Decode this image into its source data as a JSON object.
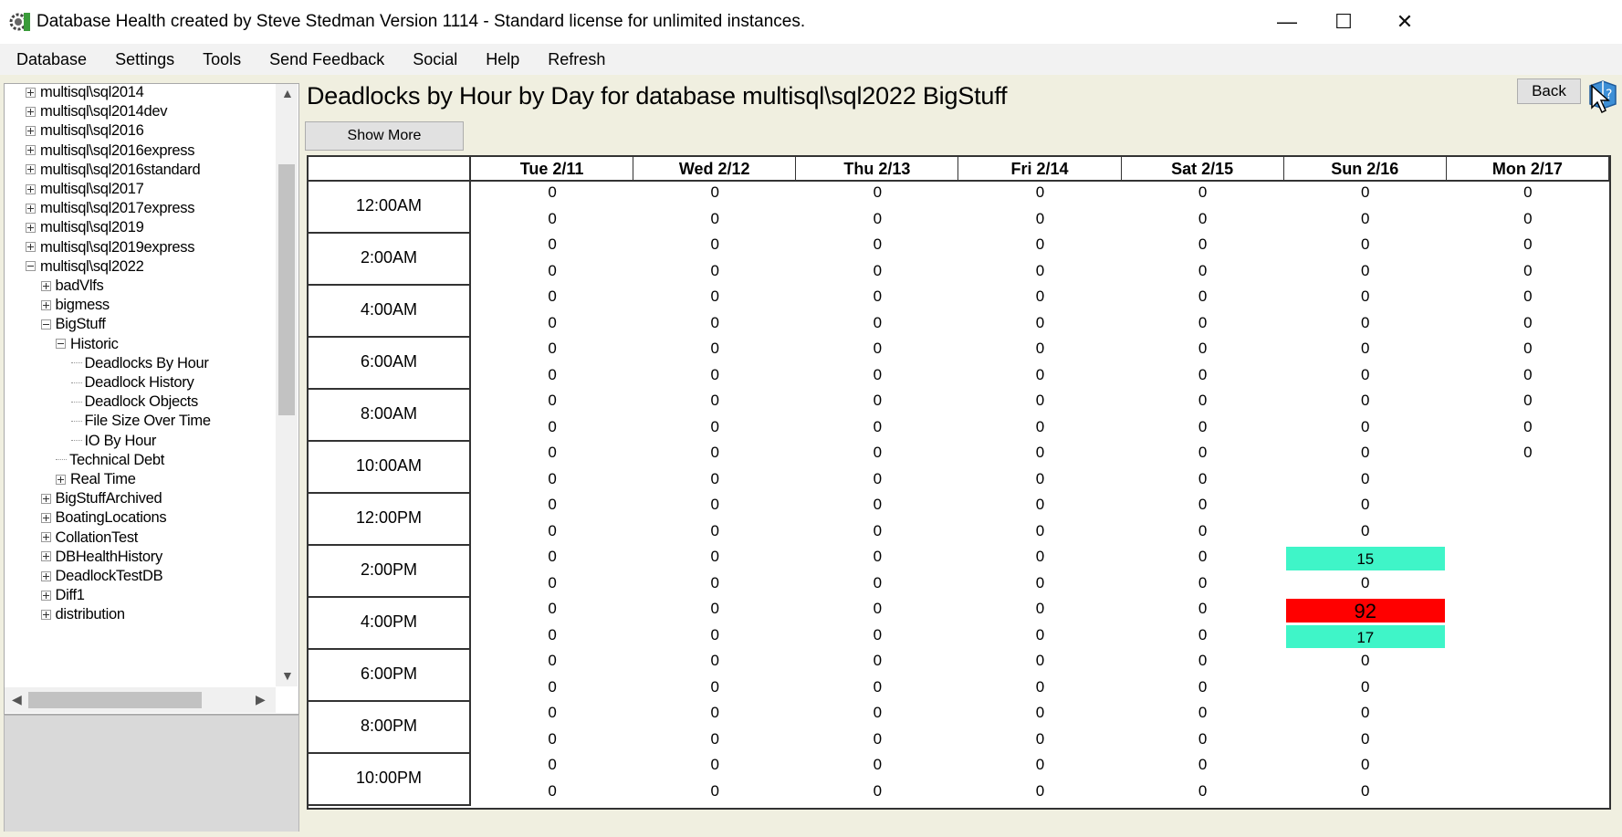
{
  "window": {
    "title": "Database Health created by Steve Stedman Version 1114 - Standard license for unlimited instances.",
    "minimize": "—",
    "maximize": "☐",
    "close": "✕"
  },
  "menu": [
    "Database",
    "Settings",
    "Tools",
    "Send Feedback",
    "Social",
    "Help",
    "Refresh"
  ],
  "tree": [
    {
      "label": "multisql\\sql2014",
      "indent": 0,
      "type": "plus"
    },
    {
      "label": "multisql\\sql2014dev",
      "indent": 0,
      "type": "plus"
    },
    {
      "label": "multisql\\sql2016",
      "indent": 0,
      "type": "plus"
    },
    {
      "label": "multisql\\sql2016express",
      "indent": 0,
      "type": "plus"
    },
    {
      "label": "multisql\\sql2016standard",
      "indent": 0,
      "type": "plus"
    },
    {
      "label": "multisql\\sql2017",
      "indent": 0,
      "type": "plus"
    },
    {
      "label": "multisql\\sql2017express",
      "indent": 0,
      "type": "plus"
    },
    {
      "label": "multisql\\sql2019",
      "indent": 0,
      "type": "plus"
    },
    {
      "label": "multisql\\sql2019express",
      "indent": 0,
      "type": "plus"
    },
    {
      "label": "multisql\\sql2022",
      "indent": 0,
      "type": "minus"
    },
    {
      "label": "badVlfs",
      "indent": 1,
      "type": "plus"
    },
    {
      "label": "bigmess",
      "indent": 1,
      "type": "plus"
    },
    {
      "label": "BigStuff",
      "indent": 1,
      "type": "minus"
    },
    {
      "label": "Historic",
      "indent": 2,
      "type": "minus"
    },
    {
      "label": "Deadlocks By Hour",
      "indent": 3,
      "type": "leaf"
    },
    {
      "label": "Deadlock History",
      "indent": 3,
      "type": "leaf"
    },
    {
      "label": "Deadlock Objects",
      "indent": 3,
      "type": "leaf"
    },
    {
      "label": "File Size Over Time",
      "indent": 3,
      "type": "leaf"
    },
    {
      "label": "IO By Hour",
      "indent": 3,
      "type": "leaf"
    },
    {
      "label": "Technical Debt",
      "indent": 2,
      "type": "leaf"
    },
    {
      "label": "Real Time",
      "indent": 2,
      "type": "plus"
    },
    {
      "label": "BigStuffArchived",
      "indent": 1,
      "type": "plus"
    },
    {
      "label": "BoatingLocations",
      "indent": 1,
      "type": "plus"
    },
    {
      "label": "CollationTest",
      "indent": 1,
      "type": "plus"
    },
    {
      "label": "DBHealthHistory",
      "indent": 1,
      "type": "plus"
    },
    {
      "label": "DeadlockTestDB",
      "indent": 1,
      "type": "plus"
    },
    {
      "label": "Diff1",
      "indent": 1,
      "type": "plus"
    },
    {
      "label": "distribution",
      "indent": 1,
      "type": "plus"
    }
  ],
  "report": {
    "title": "Deadlocks by Hour by Day for database multisql\\sql2022 BigStuff",
    "show_more": "Show More",
    "back": "Back"
  },
  "grid": {
    "days": [
      "Tue 2/11",
      "Wed 2/12",
      "Thu 2/13",
      "Fri 2/14",
      "Sat 2/15",
      "Sun 2/16",
      "Mon 2/17"
    ],
    "hour_labels": [
      "12:00AM",
      "2:00AM",
      "4:00AM",
      "6:00AM",
      "8:00AM",
      "10:00AM",
      "12:00PM",
      "2:00PM",
      "4:00PM",
      "6:00PM",
      "8:00PM",
      "10:00PM"
    ],
    "values": [
      [
        0,
        0,
        0,
        0,
        0,
        0,
        0,
        0,
        0,
        0,
        0,
        0,
        0,
        0,
        0,
        0,
        0,
        0,
        0,
        0,
        0,
        0,
        0,
        0
      ],
      [
        0,
        0,
        0,
        0,
        0,
        0,
        0,
        0,
        0,
        0,
        0,
        0,
        0,
        0,
        0,
        0,
        0,
        0,
        0,
        0,
        0,
        0,
        0,
        0
      ],
      [
        0,
        0,
        0,
        0,
        0,
        0,
        0,
        0,
        0,
        0,
        0,
        0,
        0,
        0,
        0,
        0,
        0,
        0,
        0,
        0,
        0,
        0,
        0,
        0
      ],
      [
        0,
        0,
        0,
        0,
        0,
        0,
        0,
        0,
        0,
        0,
        0,
        0,
        0,
        0,
        0,
        0,
        0,
        0,
        0,
        0,
        0,
        0,
        0,
        0
      ],
      [
        0,
        0,
        0,
        0,
        0,
        0,
        0,
        0,
        0,
        0,
        0,
        0,
        0,
        0,
        0,
        0,
        0,
        0,
        0,
        0,
        0,
        0,
        0,
        0
      ],
      [
        0,
        0,
        0,
        0,
        0,
        0,
        0,
        0,
        0,
        0,
        0,
        0,
        0,
        0,
        15,
        0,
        92,
        17,
        0,
        0,
        0,
        0,
        0,
        0
      ],
      [
        0,
        0,
        0,
        0,
        0,
        0,
        0,
        0,
        0,
        0,
        0,
        null,
        null,
        null,
        null,
        null,
        null,
        null,
        null,
        null,
        null,
        null,
        null,
        null
      ]
    ],
    "highlight_color": "#3ff5c8",
    "hot_color": "#ff0000",
    "hot_threshold": 50
  }
}
